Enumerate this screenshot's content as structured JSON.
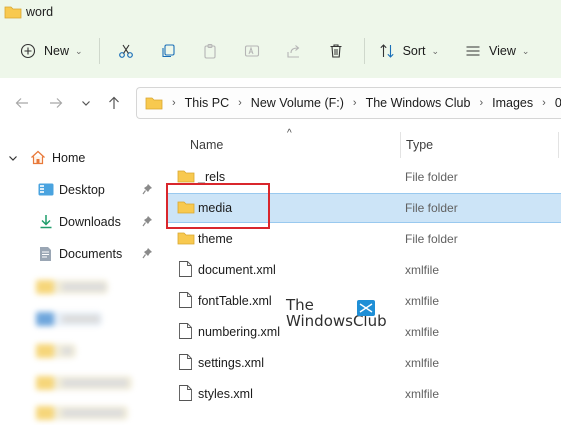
{
  "window": {
    "title": "word"
  },
  "toolbar": {
    "new_label": "New",
    "sort_label": "Sort",
    "view_label": "View",
    "icons": [
      "plus-circle-icon",
      "scissors-icon",
      "copy-icon",
      "paste-icon",
      "rename-icon",
      "share-icon",
      "delete-icon",
      "sort-icon",
      "view-icon"
    ]
  },
  "address": {
    "breadcrumbs": [
      "This PC",
      "New Volume (F:)",
      "The Windows Club",
      "Images",
      "0"
    ]
  },
  "sidebar": {
    "home_label": "Home",
    "items": [
      {
        "label": "Desktop",
        "icon": "desktop-icon",
        "pinned": true
      },
      {
        "label": "Downloads",
        "icon": "download-icon",
        "pinned": true
      },
      {
        "label": "Documents",
        "icon": "documents-icon",
        "pinned": true
      }
    ]
  },
  "columns": {
    "name": "Name",
    "type": "Type"
  },
  "files": [
    {
      "name": "_rels",
      "type": "File folder",
      "icon": "folder-icon"
    },
    {
      "name": "media",
      "type": "File folder",
      "icon": "folder-icon",
      "selected": true
    },
    {
      "name": "theme",
      "type": "File folder",
      "icon": "folder-icon"
    },
    {
      "name": "document.xml",
      "type": "xmlfile",
      "icon": "file-icon"
    },
    {
      "name": "fontTable.xml",
      "type": "xmlfile",
      "icon": "file-icon"
    },
    {
      "name": "numbering.xml",
      "type": "xmlfile",
      "icon": "file-icon"
    },
    {
      "name": "settings.xml",
      "type": "xmlfile",
      "icon": "file-icon"
    },
    {
      "name": "styles.xml",
      "type": "xmlfile",
      "icon": "file-icon"
    }
  ],
  "watermark": {
    "line1": "The",
    "line2": "WindowsClub"
  },
  "colors": {
    "accent": "#0067c0",
    "selection": "#cce4f7",
    "folder": "#f8c94f",
    "highlight": "#d9262c",
    "toolbar_bg": "#eef7ea"
  }
}
